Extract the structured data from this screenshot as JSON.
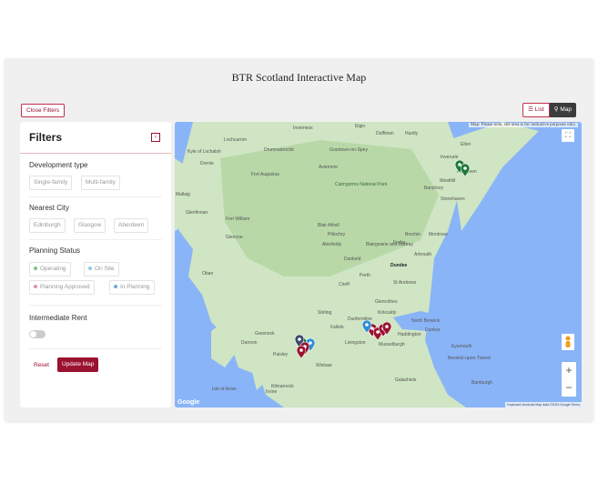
{
  "page": {
    "title": "BTR Scotland Interactive Map"
  },
  "toolbar": {
    "close_filters": "Close Filters",
    "list_label": "List",
    "map_label": "Map"
  },
  "filters": {
    "title": "Filters",
    "collapse_glyph": "‹",
    "development_type": {
      "label": "Development type",
      "options": [
        "Single-family",
        "Multi-family"
      ]
    },
    "nearest_city": {
      "label": "Nearest City",
      "options": [
        "Edinburgh",
        "Glasgow",
        "Aberdeen"
      ]
    },
    "planning_status": {
      "label": "Planning Status",
      "options": [
        {
          "label": "Operating",
          "color": "#7bc47f"
        },
        {
          "label": "On Site",
          "color": "#8ec9e8"
        },
        {
          "label": "Planning Approved",
          "color": "#e88aa6"
        },
        {
          "label": "In Planning",
          "color": "#6aa7e0"
        }
      ]
    },
    "intermediate_rent": {
      "label": "Intermediate Rent",
      "value": false
    },
    "reset_label": "Reset",
    "update_label": "Update Map"
  },
  "map": {
    "note": "Map: Please note, site area is for indicative purposes only.",
    "fullscreen_glyph": "⛶",
    "zoom_in": "+",
    "zoom_out": "−",
    "google_logo": "Google",
    "attribution": "Keyboard shortcuts   Map data ©2024 Google   Terms",
    "colors": {
      "sea": "#8ab4f8",
      "land": "#cfe5c3",
      "highland": "#b8d8a8",
      "water_inland": "#8ab4f8"
    },
    "labels": [
      "Inverness",
      "Lochcarron",
      "Kyle of Lochalsh",
      "Dornie",
      "Drumnadrochit",
      "Grantown-on-Spey",
      "Aviemore",
      "Fort Augustus",
      "Cairngorms National Park",
      "Mallaig",
      "Glenfinnan",
      "Fort William",
      "Glencoe",
      "Blair Atholl",
      "Pitlochry",
      "Aberfeldy",
      "Blairgowrie and Rattray",
      "Forfar",
      "Montrose",
      "Brechin",
      "Arbroath",
      "Dundee",
      "St Andrews",
      "Perth",
      "Glenrothes",
      "Stirling",
      "Kirkcaldy",
      "Dunfermline",
      "Falkirk",
      "Livingston",
      "Musselburgh",
      "Haddington",
      "North Berwick",
      "Dunbar",
      "Eyemouth",
      "Berwick-upon-Tweed",
      "Galashiels",
      "Kilmarnock",
      "Paisley",
      "Wishaw",
      "Greenock",
      "Dunoon",
      "Oban",
      "Isle of Arran",
      "Irvine",
      "Ellon",
      "Inverurie",
      "Aberdeen",
      "Westhill",
      "Banchory",
      "Stonehaven",
      "Dufftown",
      "Huntly",
      "Elgin",
      "Dunkeld",
      "Crieff",
      "Bamburgh"
    ],
    "pins": [
      {
        "name": "aberdeen",
        "color": "#1e7a3a"
      },
      {
        "name": "aberdeen",
        "color": "#1e7a3a"
      },
      {
        "name": "edinburgh",
        "color": "#9b1230"
      },
      {
        "name": "edinburgh",
        "color": "#9b1230"
      },
      {
        "name": "edinburgh",
        "color": "#9b1230"
      },
      {
        "name": "edinburgh",
        "color": "#9b1230"
      },
      {
        "name": "livingston",
        "color": "#2f8dd6"
      },
      {
        "name": "glasgow",
        "color": "#1e7a3a"
      },
      {
        "name": "glasgow",
        "color": "#2f8dd6"
      },
      {
        "name": "glasgow",
        "color": "#3a4a6a"
      },
      {
        "name": "glasgow",
        "color": "#9b1230"
      },
      {
        "name": "glasgow",
        "color": "#9b1230"
      }
    ]
  }
}
